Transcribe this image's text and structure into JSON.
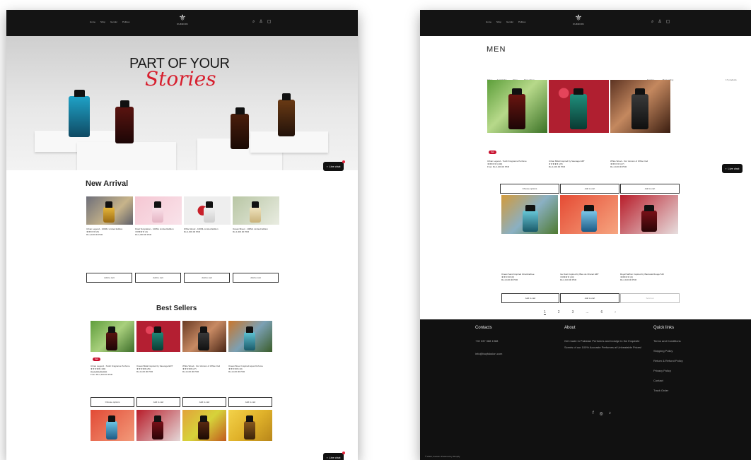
{
  "left_page": {
    "nav": {
      "items": [
        "Home",
        "Shop",
        "Gender",
        "Policies"
      ]
    },
    "logo_text": "FUKSION",
    "hero": {
      "title_line1": "PART OF YOUR",
      "title_line2": "Stories"
    },
    "new_arrival": {
      "title": "New Arrival",
      "products": [
        {
          "name": "Urban Legend - 100ML Limited Edition",
          "stars": "★★★★★ (5)",
          "price": "Rs.2,100.00 PKR",
          "button": "Add to cart"
        },
        {
          "name": "Petal Temptation - 100ML Limited Edition",
          "stars": "★★★★★ (3)",
          "price": "Rs.2,300.00 PKR",
          "button": "Add to cart"
        },
        {
          "name": "White Wood - 100ML Limited Edition",
          "stars": "",
          "price": "Rs.2,300.00 PKR",
          "button": "Add to cart"
        },
        {
          "name": "Ocean Breez - 100ML Limited Edition",
          "stars": "",
          "price": "Rs.2,400.00 PKR",
          "button": "Add to cart"
        }
      ]
    },
    "best_sellers": {
      "title": "Best Sellers",
      "sale_badge": "Sale",
      "products": [
        {
          "name": "Urban Legend - Tooth Fragrance Perfume",
          "stars": "★★★★★ (100)",
          "old_price": "Rs.2,400.00 PKR",
          "price": "From Rs.2,100.00 PKR",
          "button": "Choose options"
        },
        {
          "name": "Ocean Bidal Inspired by Sauvage EDT",
          "stars": "★★★★★ (25)",
          "price": "Rs.2,100.00 PKR",
          "button": "Add to cart"
        },
        {
          "name": "White Wood - Our Version of White Oud",
          "stars": "★★★★★ (27)",
          "price": "Rs.2,100.00 PKR",
          "button": "Add to cart"
        },
        {
          "name": "Ocean Breez Inspired Aqua Perfume",
          "stars": "★★★★★ (10)",
          "price": "Rs.2,100.00 PKR",
          "button": "Add to cart"
        }
      ]
    },
    "live_chat": "Live chat"
  },
  "right_page": {
    "nav": {
      "items": [
        "Home",
        "Shop",
        "Gender",
        "Policies"
      ]
    },
    "logo_text": "FUKSION",
    "heading": "MEN",
    "filters": {
      "filter_label": "Filter:",
      "availability": "Availability",
      "price": "Price",
      "more": "More filters",
      "sort_label": "Sort by:",
      "sort_value": "Best selling",
      "count": "17 products"
    },
    "products_row1": [
      {
        "name": "Urban Legend - Tooth Fragrance Perfume",
        "stars": "★★★★★ (100)",
        "price": "From Rs.2,100.00 PKR",
        "button": "Choose options"
      },
      {
        "name": "Urban Bidal Inspired by Sauvage EDT",
        "stars": "★★★★★ (25)",
        "price": "Rs.2,100.00 PKR",
        "button": "Add to cart"
      },
      {
        "name": "White Wood - Our Version of White Oud",
        "stars": "★★★★★ (27)",
        "price": "Rs.2,100.00 PKR",
        "button": "Add to cart"
      }
    ],
    "products_row2": [
      {
        "name": "Ocean Sand Inspired Ghambarbee",
        "stars": "★★★★★ (8)",
        "price": "Rs.2,100.00 PKR",
        "button": "Add to cart"
      },
      {
        "name": "Ice Dust Inspired by Bleu de Chanel EDT",
        "stars": "★★★★★ (20)",
        "price": "Rs.2,100.00 PKR",
        "button": "Add to cart"
      },
      {
        "name": "Royal Saffron Inspired by Baccarat Rouge 540",
        "stars": "★★★★★ (9)",
        "price": "Rs.2,100.00 PKR",
        "button": "Sold out"
      }
    ],
    "sale_badge": "Sale",
    "pagination": [
      "1",
      "2",
      "3",
      "...",
      "6",
      "›"
    ],
    "footer": {
      "contacts_title": "Contacts",
      "phone": "+92 337 388 1988",
      "email": "info@buyfuksion.com",
      "about_title": "About",
      "about_text": "Get made in Pakistan Perfumes and indulge in the Exquisite Scents of our 100% Accurate Perfumes at Unbeatable Prices!",
      "links_title": "Quick links",
      "links": [
        "Terms and Conditions",
        "Shipping Policy",
        "Return & Refund Policy",
        "Privacy Policy",
        "Contact",
        "Track Order"
      ],
      "copyright": "© 2024, Fuksion Powered by Shopify"
    },
    "live_chat": "Live chat"
  }
}
